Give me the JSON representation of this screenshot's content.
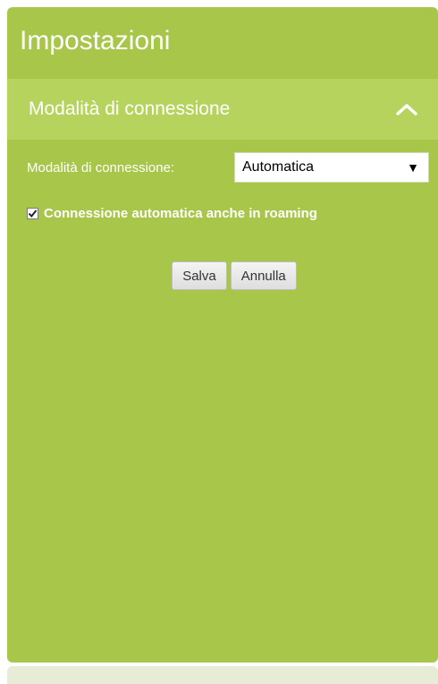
{
  "panel": {
    "title": "Impostazioni"
  },
  "section": {
    "title": "Modalità di connessione",
    "toggle_icon": "chevron-up-icon"
  },
  "connection_mode": {
    "label": "Modalità di connessione:",
    "selected": "Automatica",
    "dropdown_icon": "triangle-down-icon"
  },
  "roaming": {
    "label": "Connessione automatica anche in roaming",
    "checked": true
  },
  "buttons": {
    "save_label": "Salva",
    "cancel_label": "Annulla"
  },
  "colors": {
    "panel_bg": "#a8c64a",
    "section_bg": "#b6d35d",
    "text": "#ffffff"
  }
}
